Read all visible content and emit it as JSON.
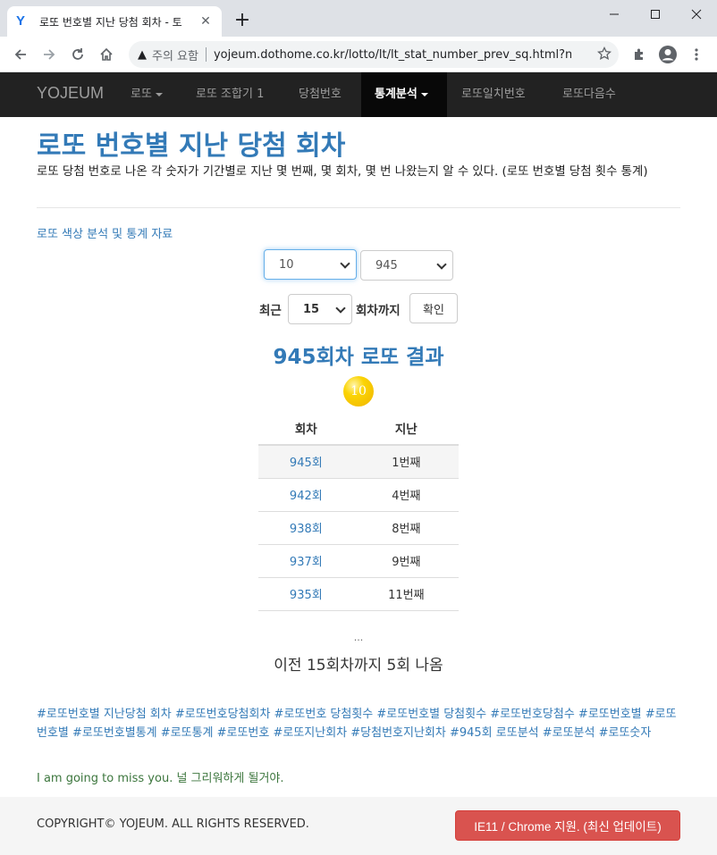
{
  "browser": {
    "tab_title": "로또 번호별 지난 당첨 회차 - 토",
    "tab_favicon": "Y",
    "new_tab_symbol": "+",
    "security_label": "주의 요함",
    "url": "yojeum.dothome.co.kr/lotto/lt/lt_stat_number_prev_sq.html?n..."
  },
  "nav": {
    "brand": "YOJEUM",
    "items": [
      {
        "label": "로또"
      },
      {
        "label": "로또 조합기 1"
      },
      {
        "label": "당첨번호"
      },
      {
        "label": "통계분석"
      },
      {
        "label": "로또일치번호"
      },
      {
        "label": "로또다음수"
      }
    ]
  },
  "page": {
    "title": "로또 번호별 지난 당첨 회차",
    "description": "로또 당첨 번호로 나온 각 숫자가 기간별로 지난 몇 번째, 몇 회차, 몇 번 나왔는지 알 수 있다. (로또 번호별 당첨 횟수 통계)",
    "color_link": "로또 색상 분석 및 통계 자료"
  },
  "form": {
    "number_select": "10",
    "round_select": "945",
    "recent_label": "최근",
    "range_select": "15",
    "until_label": "회차까지",
    "confirm_button": "확인"
  },
  "result": {
    "title": "945회차 로또 결과",
    "ball_number": "10",
    "ball_color": "#fbd404",
    "columns": [
      "회차",
      "지난"
    ],
    "rows": [
      {
        "round": "945회",
        "ago": "1번째"
      },
      {
        "round": "942회",
        "ago": "4번째"
      },
      {
        "round": "938회",
        "ago": "8번째"
      },
      {
        "round": "937회",
        "ago": "9번째"
      },
      {
        "round": "935회",
        "ago": "11번째"
      }
    ],
    "ellipsis": "...",
    "summary": "이전 15회차까지 5회 나옴"
  },
  "tags": "#로또번호별 지난당첨 회차 #로또번호당첨회차 #로또번호 당첨횟수 #로또번호별 당첨횟수 #로또번호당첨수 #로또번호별 #로또번호별 #로또번호별통계 #로또통계 #로또번호 #로또지난회차 #당첨번호지난회차 #945회 로또분석 #로또분석 #로또숫자",
  "miss_you": "I am going to miss you. 널 그리워하게 될거야.",
  "footer": {
    "copyright": "COPYRIGHT© YOJEUM. ALL RIGHTS RESERVED.",
    "support_button": "IE11 / Chrome 지원. (최신 업데이트)",
    "button_color": "#d9534f"
  }
}
